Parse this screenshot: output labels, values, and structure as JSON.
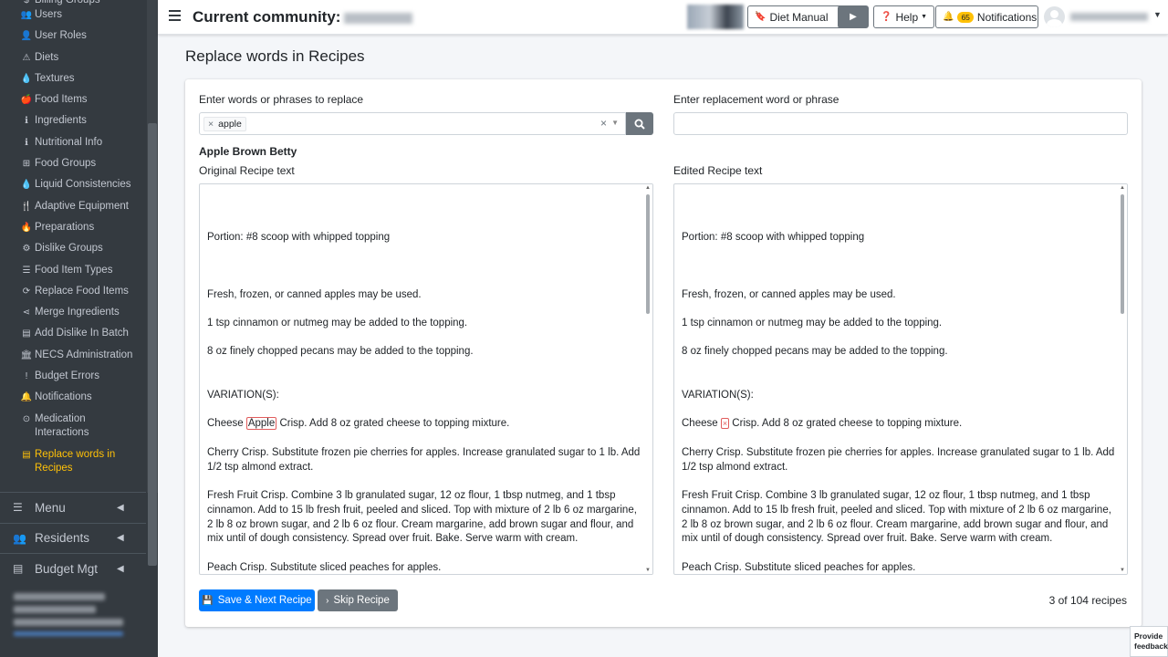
{
  "sidebar": {
    "items": [
      {
        "icon": "dollar-icon",
        "glyph": "$",
        "label": "Billing Groups"
      },
      {
        "icon": "users-icon",
        "glyph": "👥",
        "label": "Users"
      },
      {
        "icon": "user-roles-icon",
        "glyph": "👤",
        "label": "User Roles"
      },
      {
        "icon": "warning-icon",
        "glyph": "⚠",
        "label": "Diets"
      },
      {
        "icon": "droplet-icon",
        "glyph": "💧",
        "label": "Textures"
      },
      {
        "icon": "apple-icon",
        "glyph": "🍎",
        "label": "Food Items"
      },
      {
        "icon": "info-icon",
        "glyph": "ℹ",
        "label": "Ingredients"
      },
      {
        "icon": "info-icon",
        "glyph": "ℹ",
        "label": "Nutritional Info"
      },
      {
        "icon": "sitemap-icon",
        "glyph": "⊞",
        "label": "Food Groups"
      },
      {
        "icon": "droplet-icon",
        "glyph": "💧",
        "label": "Liquid Consistencies"
      },
      {
        "icon": "utensils-icon",
        "glyph": "🍴",
        "label": "Adaptive Equipment"
      },
      {
        "icon": "fire-icon",
        "glyph": "🔥",
        "label": "Preparations"
      },
      {
        "icon": "cogs-icon",
        "glyph": "⚙",
        "label": "Dislike Groups"
      },
      {
        "icon": "list-icon",
        "glyph": "☰",
        "label": "Food Item Types"
      },
      {
        "icon": "sync-icon",
        "glyph": "⟳",
        "label": "Replace Food Items"
      },
      {
        "icon": "share-icon",
        "glyph": "⋖",
        "label": "Merge Ingredients"
      },
      {
        "icon": "file-icon",
        "glyph": "▤",
        "label": "Add Dislike In Batch"
      },
      {
        "icon": "bank-icon",
        "glyph": "🏛",
        "label": "NECS Administration"
      },
      {
        "icon": "exclamation-icon",
        "glyph": "!",
        "label": "Budget Errors"
      },
      {
        "icon": "bell-icon",
        "glyph": "🔔",
        "label": "Notifications"
      },
      {
        "icon": "binoculars-icon",
        "glyph": "⊙",
        "label": "Medication Interactions"
      },
      {
        "icon": "file-text-icon",
        "glyph": "▤",
        "label": "Replace words in Recipes"
      }
    ],
    "groups": [
      {
        "icon": "menu-icon",
        "glyph": "☰",
        "label": "Menu"
      },
      {
        "icon": "residents-icon",
        "glyph": "👥",
        "label": "Residents"
      },
      {
        "icon": "budget-icon",
        "glyph": "▤",
        "label": "Budget Mgt"
      }
    ]
  },
  "topbar": {
    "title": "Current community:",
    "diet_manual": "Diet Manual",
    "help": "Help",
    "notif_count": "65",
    "notifications": "Notifications"
  },
  "page": {
    "title": "Replace words in Recipes",
    "find_label": "Enter words or phrases to replace",
    "find_tag": "apple",
    "replace_label": "Enter replacement word or phrase",
    "replace_value": "",
    "recipe_name": "Apple Brown Betty",
    "original_label": "Original Recipe text",
    "edited_label": "Edited Recipe text",
    "original": {
      "portion": "Portion:  #8 scoop with whipped topping",
      "note1": "Fresh, frozen, or canned apples may be used.",
      "note2": "1 tsp cinnamon or nutmeg may be added to the topping.",
      "note3": "8 oz finely chopped pecans may be added to the topping.",
      "variations": "VARIATION(S):",
      "cheese_pre": "Cheese ",
      "cheese_match": "Apple",
      "cheese_post": " Crisp. Add 8 oz grated cheese to topping mixture.",
      "cherry": "Cherry Crisp. Substitute frozen pie cherries for apples. Increase granulated sugar to 1 lb. Add 1/2 tsp almond extract.",
      "fresh": "Fresh Fruit Crisp. Combine 3 lb granulated sugar, 12 oz flour, 1 tbsp nutmeg, and 1 tbsp cinnamon. Add to 15 lb fresh fruit, peeled and sliced. Top with mixture of 2 lb 6 oz margarine, 2 lb 8 oz brown sugar, and 2 lb 6 oz flour. Cream margarine, add brown sugar and flour, and mix until of dough consistency. Spread over fruit. Bake. Serve warm with cream.",
      "peach": "Peach Crisp. Substitute sliced peaches for apples."
    },
    "edited_match": "×",
    "save_button": "Save & Next Recipe",
    "skip_button": "Skip Recipe",
    "count": "3 of 104 recipes"
  },
  "feedback": "Provide feedback"
}
